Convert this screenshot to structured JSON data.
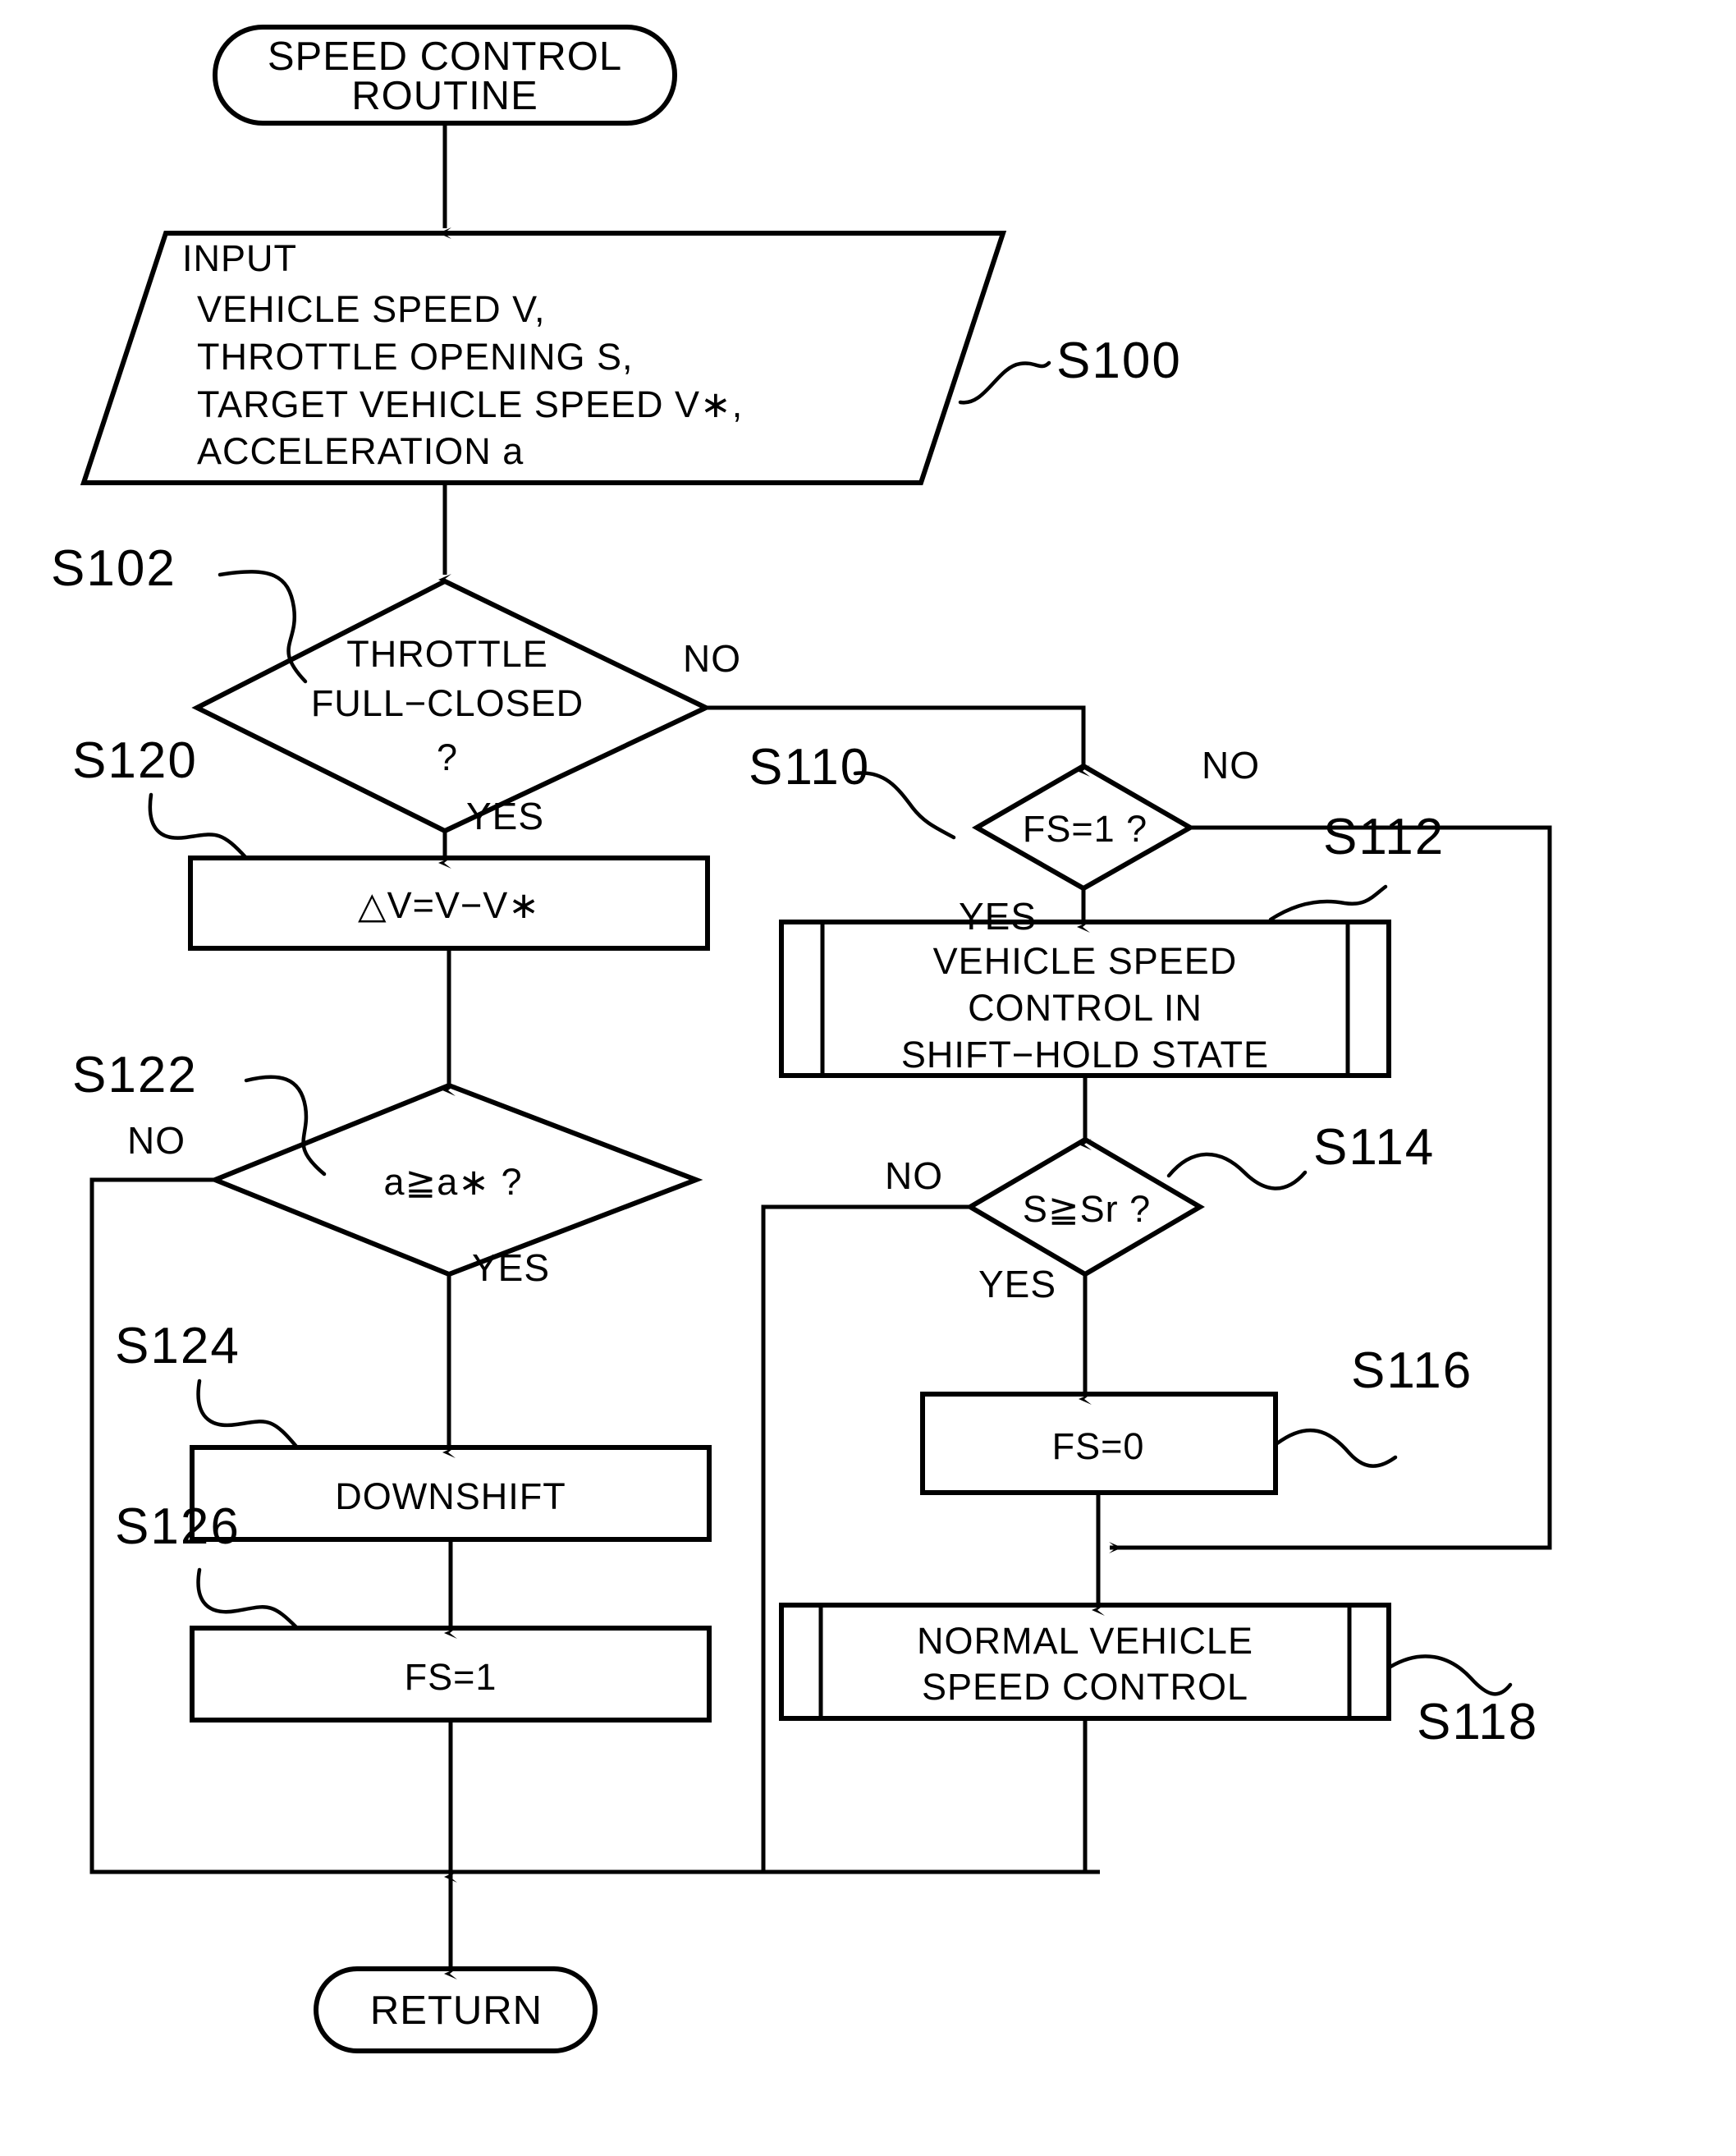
{
  "diagram": {
    "title_terminal": {
      "line1": "SPEED  CONTROL",
      "line2": "ROUTINE"
    },
    "end_terminal": {
      "label": "RETURN"
    },
    "nodes": {
      "s100": {
        "step": "S100",
        "shape": "parallelogram-input",
        "lines": [
          "INPUT",
          "VEHICLE  SPEED  V,",
          "THROTTLE  OPENING  S,",
          "TARGET  VEHICLE  SPEED  V∗,",
          "ACCELERATION  a"
        ]
      },
      "s102": {
        "step": "S102",
        "shape": "decision",
        "lines": [
          "THROTTLE",
          "FULL−CLOSED",
          "?"
        ],
        "yes_label": "YES",
        "no_label": "NO"
      },
      "s110": {
        "step": "S110",
        "shape": "decision",
        "lines": [
          "FS=1 ?"
        ],
        "yes_label": "YES",
        "no_label": "NO"
      },
      "s112": {
        "step": "S112",
        "shape": "predefined-process",
        "lines": [
          "VEHICLE  SPEED",
          "CONTROL  IN",
          "SHIFT−HOLD  STATE"
        ]
      },
      "s114": {
        "step": "S114",
        "shape": "decision",
        "lines": [
          "S≧Sr ?"
        ],
        "yes_label": "YES",
        "no_label": "NO"
      },
      "s116": {
        "step": "S116",
        "shape": "process",
        "lines": [
          "FS=0"
        ]
      },
      "s118": {
        "step": "S118",
        "shape": "predefined-process",
        "lines": [
          "NORMAL  VEHICLE",
          "SPEED  CONTROL"
        ]
      },
      "s120": {
        "step": "S120",
        "shape": "process",
        "lines": [
          "△V=V−V∗"
        ]
      },
      "s122": {
        "step": "S122",
        "shape": "decision",
        "lines": [
          "a≧a∗ ?"
        ],
        "yes_label": "YES",
        "no_label": "NO"
      },
      "s124": {
        "step": "S124",
        "shape": "process",
        "lines": [
          "DOWNSHIFT"
        ]
      },
      "s126": {
        "step": "S126",
        "shape": "process",
        "lines": [
          "FS=1"
        ]
      }
    },
    "colors": {
      "ink": "#000000",
      "paper": "#ffffff"
    }
  }
}
